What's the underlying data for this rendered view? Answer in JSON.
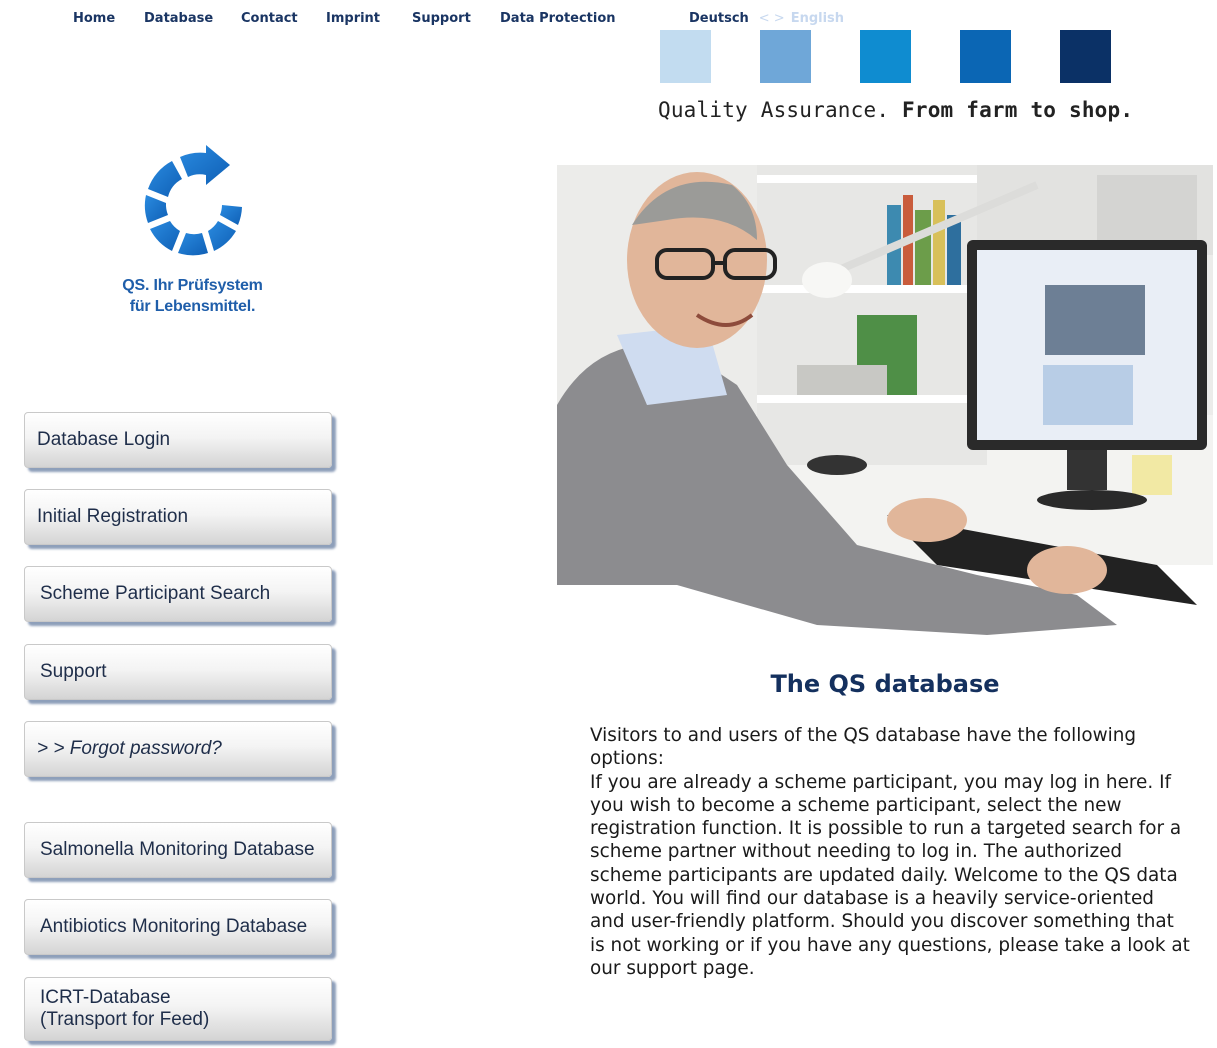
{
  "nav": {
    "items": [
      {
        "label": "Home"
      },
      {
        "label": "Database"
      },
      {
        "label": "Contact"
      },
      {
        "label": "Imprint"
      },
      {
        "label": "Support"
      },
      {
        "label": "Data Protection"
      }
    ]
  },
  "language": {
    "german": "Deutsch",
    "separator": "< >",
    "english": "English"
  },
  "brand": {
    "squares": [
      "#c2dcf0",
      "#6fa7d8",
      "#0f8cd0",
      "#0b66b4",
      "#0b3166"
    ],
    "tagline_light": "Quality Assurance.",
    "tagline_bold": "From farm to shop.",
    "logo_line1": "QS. Ihr Prüfsystem",
    "logo_line2": "für Lebensmittel.",
    "logo_color": "#1f5eaa"
  },
  "sidebar": {
    "buttons": [
      {
        "label": "Database Login"
      },
      {
        "label": "Initial Registration"
      },
      {
        "label": "Scheme Participant Search"
      },
      {
        "label": "Support"
      },
      {
        "label": "> > Forgot password?"
      },
      {
        "label": "Salmonella Monitoring Database"
      },
      {
        "label": "Antibiotics Monitoring Database"
      },
      {
        "label_line1": "ICRT-Database",
        "label_line2": "(Transport for Feed)"
      }
    ]
  },
  "main": {
    "title": "The QS database",
    "intro": "Visitors to and users of the QS database have the following options:",
    "body": "If you are already a scheme participant, you may log in here. If you wish to become a scheme participant, select the new registration function. It is possible to run a targeted search for a scheme partner without needing to log in. The authorized scheme participants are updated daily. Welcome to the QS data world. You will find our database is a heavily service-oriented and user-friendly platform. Should you discover something that is not working or if you have any questions, please take a look at our support page."
  }
}
